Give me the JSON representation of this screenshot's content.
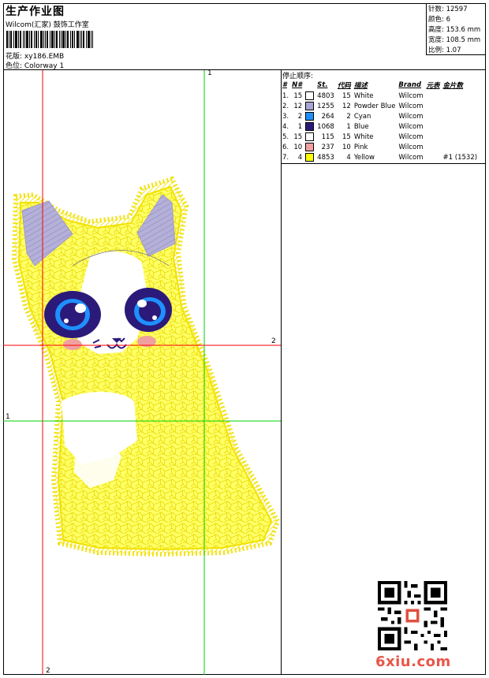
{
  "header": {
    "title": "生产作业图",
    "subtitle": "Wilcom(汇家) 鼓饰工作室",
    "pattern_label": "花版: xy186.EMB",
    "colorway_label": "色位:  Colorway 1"
  },
  "stats": {
    "stitches": "针数: 12597",
    "colors": "颜色: 6",
    "height": "高度: 153.6 mm",
    "width": "宽度: 108.5 mm",
    "scale": "比例: 1.07"
  },
  "sequence": {
    "title": "停止顺序:",
    "columns": [
      "#",
      "N#",
      "St.",
      "代码",
      "描述",
      "Brand",
      "元表",
      "金片数"
    ],
    "rows": [
      {
        "num": "1.",
        "n": "15",
        "color": "#ffffff",
        "st": "4803",
        "code": "15",
        "desc": "White",
        "brand": "Wilcom",
        "extra": ""
      },
      {
        "num": "2.",
        "n": "12",
        "color": "#a7a7d6",
        "st": "1255",
        "code": "12",
        "desc": "Powder Blue",
        "brand": "Wilcom",
        "extra": ""
      },
      {
        "num": "3.",
        "n": "2",
        "color": "#1e90ff",
        "st": "264",
        "code": "2",
        "desc": "Cyan",
        "brand": "Wilcom",
        "extra": ""
      },
      {
        "num": "4.",
        "n": "1",
        "color": "#2b1a7a",
        "st": "1068",
        "code": "1",
        "desc": "Blue",
        "brand": "Wilcom",
        "extra": ""
      },
      {
        "num": "5.",
        "n": "15",
        "color": "#ffffff",
        "st": "115",
        "code": "15",
        "desc": "White",
        "brand": "Wilcom",
        "extra": ""
      },
      {
        "num": "6.",
        "n": "10",
        "color": "#f0a0a0",
        "st": "237",
        "code": "10",
        "desc": "Pink",
        "brand": "Wilcom",
        "extra": ""
      },
      {
        "num": "7.",
        "n": "4",
        "color": "#ffff00",
        "st": "4853",
        "code": "4",
        "desc": "Yellow",
        "brand": "Wilcom",
        "extra": "#1 (1532)"
      }
    ]
  },
  "guides": {
    "h1_label": "2",
    "h2_label": "1",
    "v1_label": "2",
    "v2_label": "1"
  },
  "watermark": "6xiu.com",
  "colors": {
    "guide_red": "#ff0000",
    "guide_green": "#00d000",
    "yellow_fill": "#ffff00",
    "ear_purple": "#b4b0d8"
  }
}
